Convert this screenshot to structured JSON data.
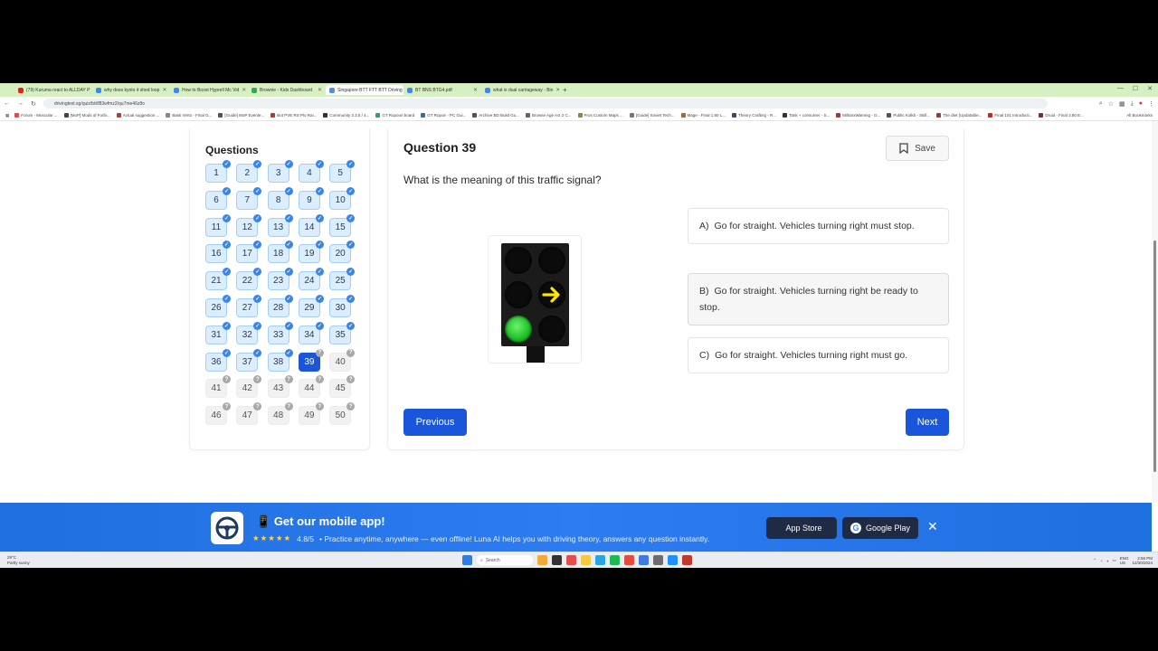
{
  "browser": {
    "tabs": [
      {
        "title": "(79) Kuruma react to ALLDAY P",
        "color": "#e62117"
      },
      {
        "title": "why does kyoto it shed loop",
        "color": "#4285f4"
      },
      {
        "title": "How to Boost Hyprell Mc Vid",
        "color": "#4285f4"
      },
      {
        "title": "Brownie - Kids Dashboard",
        "color": "#34a853"
      },
      {
        "title": "Singapore BTT FTT BTT Driving",
        "color": "#4a90d9",
        "active": true
      },
      {
        "title": "BT BNS BTG4.pdf",
        "color": "#4285f4"
      },
      {
        "title": "what is dual carriageway - Bin",
        "color": "#4285f4"
      }
    ],
    "url": "drivingtest.sg/quiz/btt/f83wfmz2/qu7me46z8o",
    "bookmarks": [
      "Forum - Muscular ...",
      "[MoP] Mods of Forbi...",
      "Actual suggestion ...",
      "Basti Verto - Final G...",
      "[Guide] MoP Evente...",
      "Bot PVE RS Plo Rai...",
      "Community 3.3.5 / 4...",
      "GT Rupoori board",
      "GT Rupoir - PC Gui...",
      "Archive BD Build Gu...",
      "Browse Age Act 2 C...",
      "Pros Custom Maps ...",
      "[Guide] Soviet Tech...",
      "Mage - Final 1.80 L...",
      "Theory Crafting - R...",
      "Tank + consumer - S...",
      "MilitarxWarning - G...",
      "Public Kolkb - Skill...",
      "The diet (Updatable...",
      "Final 101 Introducti...",
      "Druid - Final 3.80 E..."
    ],
    "all_bookmarks": "All Bookmarks"
  },
  "sidebar": {
    "title": "Questions",
    "questions": [
      {
        "n": "1",
        "status": "done"
      },
      {
        "n": "2",
        "status": "done"
      },
      {
        "n": "3",
        "status": "done"
      },
      {
        "n": "4",
        "status": "done"
      },
      {
        "n": "5",
        "status": "done"
      },
      {
        "n": "6",
        "status": "done"
      },
      {
        "n": "7",
        "status": "done"
      },
      {
        "n": "8",
        "status": "done"
      },
      {
        "n": "9",
        "status": "done"
      },
      {
        "n": "10",
        "status": "done"
      },
      {
        "n": "11",
        "status": "done"
      },
      {
        "n": "12",
        "status": "done"
      },
      {
        "n": "13",
        "status": "done"
      },
      {
        "n": "14",
        "status": "done"
      },
      {
        "n": "15",
        "status": "done"
      },
      {
        "n": "16",
        "status": "done"
      },
      {
        "n": "17",
        "status": "done"
      },
      {
        "n": "18",
        "status": "done"
      },
      {
        "n": "19",
        "status": "done"
      },
      {
        "n": "20",
        "status": "done"
      },
      {
        "n": "21",
        "status": "done"
      },
      {
        "n": "22",
        "status": "done"
      },
      {
        "n": "23",
        "status": "done"
      },
      {
        "n": "24",
        "status": "done"
      },
      {
        "n": "25",
        "status": "done"
      },
      {
        "n": "26",
        "status": "done"
      },
      {
        "n": "27",
        "status": "done"
      },
      {
        "n": "28",
        "status": "done"
      },
      {
        "n": "29",
        "status": "done"
      },
      {
        "n": "30",
        "status": "done"
      },
      {
        "n": "31",
        "status": "done"
      },
      {
        "n": "32",
        "status": "done"
      },
      {
        "n": "33",
        "status": "done"
      },
      {
        "n": "34",
        "status": "done"
      },
      {
        "n": "35",
        "status": "done"
      },
      {
        "n": "36",
        "status": "done"
      },
      {
        "n": "37",
        "status": "done"
      },
      {
        "n": "38",
        "status": "done"
      },
      {
        "n": "39",
        "status": "current"
      },
      {
        "n": "40",
        "status": "todo"
      },
      {
        "n": "41",
        "status": "todo"
      },
      {
        "n": "42",
        "status": "todo"
      },
      {
        "n": "43",
        "status": "todo"
      },
      {
        "n": "44",
        "status": "todo"
      },
      {
        "n": "45",
        "status": "todo"
      },
      {
        "n": "46",
        "status": "todo"
      },
      {
        "n": "47",
        "status": "todo"
      },
      {
        "n": "48",
        "status": "todo"
      },
      {
        "n": "49",
        "status": "todo"
      },
      {
        "n": "50",
        "status": "todo"
      }
    ]
  },
  "main": {
    "question_title": "Question 39",
    "save_label": "Save",
    "question_text": "What is the meaning of this traffic signal?",
    "signal": {
      "lit": [
        "green-circle",
        "yellow-right-arrow"
      ],
      "colors": {
        "green": "#1fc12b",
        "yellow": "#ffe600"
      }
    },
    "options": [
      {
        "letter": "A)",
        "text": "Go for straight. Vehicles turning right must stop."
      },
      {
        "letter": "B)",
        "text": "Go for straight. Vehicles turning right be ready to stop."
      },
      {
        "letter": "C)",
        "text": "Go for straight. Vehicles turning right must go."
      }
    ],
    "previous_label": "Previous",
    "next_label": "Next"
  },
  "promo": {
    "title_emoji": "📱",
    "title": "Get our mobile app!",
    "stars": "★★★★★",
    "rating": "4.8/5",
    "tagline": "• Practice anytime, anywhere — even offline! Luna AI helps you with driving theory, answers any question instantly.",
    "app_store_label": "App Store",
    "google_play_label": "Google Play",
    "close_glyph": "✕"
  },
  "taskbar": {
    "weather_temp": "29°C",
    "weather_desc": "Partly sunny",
    "search_placeholder": "Search",
    "lang": "ENG",
    "lang2": "US",
    "time": "2:56 PM",
    "date": "12/30/2024"
  },
  "colors": {
    "accent": "#1a56db",
    "tabbar": "#d7f0c2",
    "promo": "#2d7cf0"
  }
}
